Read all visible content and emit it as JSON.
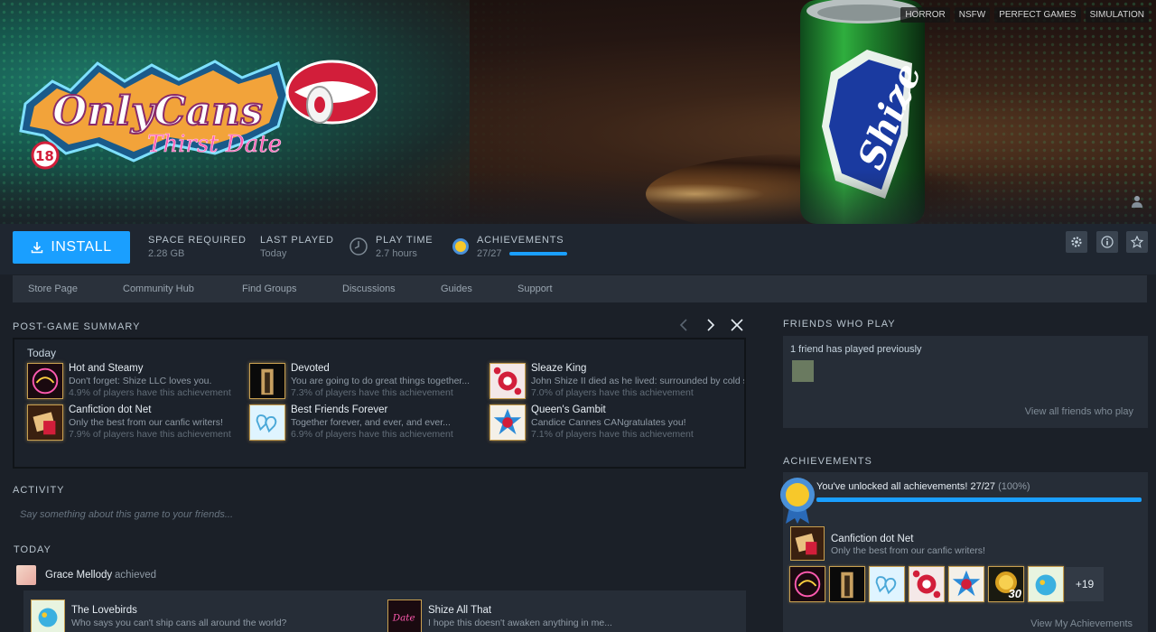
{
  "hero": {
    "tags": [
      "HORROR",
      "NSFW",
      "PERFECT GAMES",
      "SIMULATION"
    ],
    "logo_title": "OnlyCans",
    "logo_subtitle": "Thirst Date",
    "age_rating": "18",
    "can_brand": "Shize"
  },
  "actionbar": {
    "install_label": "INSTALL",
    "space_label": "SPACE REQUIRED",
    "space_value": "2.28 GB",
    "last_played_label": "LAST PLAYED",
    "last_played_value": "Today",
    "play_time_label": "PLAY TIME",
    "play_time_value": "2.7 hours",
    "achievements_label": "ACHIEVEMENTS",
    "achievements_value": "27/27",
    "achievements_progress": 1.0
  },
  "nav": [
    "Store Page",
    "Community Hub",
    "Find Groups",
    "Discussions",
    "Guides",
    "Support"
  ],
  "post_game": {
    "title": "POST-GAME SUMMARY",
    "day": "Today",
    "achievements": [
      {
        "name": "Hot and Steamy",
        "desc": "Don't forget: Shize LLC loves you.",
        "pct": "4.9% of players have this achievement",
        "icon": "hot-steamy"
      },
      {
        "name": "Devoted",
        "desc": "You are going to do great things together...",
        "pct": "7.3% of players have this achievement",
        "icon": "devoted"
      },
      {
        "name": "Sleaze King",
        "desc": "John Shize II died as he lived: surrounded by cold shizes",
        "pct": "7.0% of players have this achievement",
        "icon": "sleaze-king"
      },
      {
        "name": "Canfiction dot Net",
        "desc": "Only the best from our canfic writers!",
        "pct": "7.9% of players have this achievement",
        "icon": "canfiction"
      },
      {
        "name": "Best Friends Forever",
        "desc": "Together forever, and ever, and ever...",
        "pct": "6.9% of players have this achievement",
        "icon": "bff"
      },
      {
        "name": "Queen's Gambit",
        "desc": "Candice Cannes CANgratulates you!",
        "pct": "7.1% of players have this achievement",
        "icon": "queens-gambit"
      }
    ]
  },
  "activity": {
    "title": "ACTIVITY",
    "placeholder": "Say something about this game to your friends...",
    "today_label": "TODAY",
    "user": "Grace Mellody",
    "action": "achieved",
    "items": [
      {
        "name": "The Lovebirds",
        "desc": "Who says you can't ship cans all around the world?"
      },
      {
        "name": "Shize All That",
        "desc": "I hope this doesn't awaken anything in me..."
      }
    ]
  },
  "friends": {
    "title": "FRIENDS WHO PLAY",
    "text": "1 friend has played previously",
    "link": "View all friends who play"
  },
  "achievements_panel": {
    "title": "ACHIEVEMENTS",
    "unlocked_text": "You've unlocked all achievements! 27/27",
    "unlocked_pct": "(100%)",
    "progress": 1.0,
    "recent_name": "Canfiction dot Net",
    "recent_desc": "Only the best from our canfic writers!",
    "more_count": "+19",
    "coin_badge": "30",
    "link": "View My Achievements"
  },
  "colors": {
    "accent": "#1a9fff",
    "background": "#1b2028",
    "panel": "#262d37"
  }
}
